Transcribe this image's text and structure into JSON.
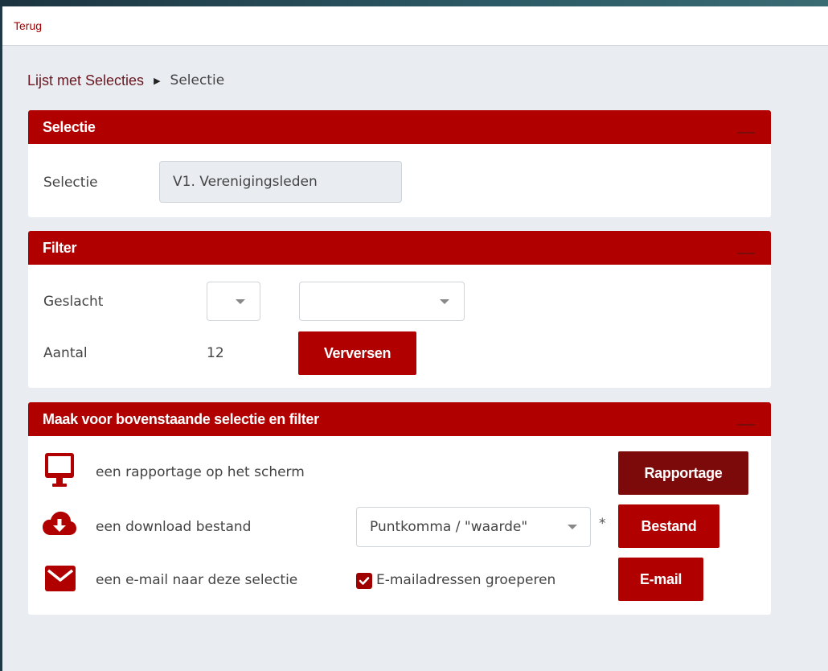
{
  "topbar": {
    "back_label": "Terug"
  },
  "breadcrumb": {
    "parent": "Lijst met Selecties",
    "current": "Selectie"
  },
  "selectie_panel": {
    "title": "Selectie",
    "field_label": "Selectie",
    "field_value": "V1. Verenigingsleden"
  },
  "filter_panel": {
    "title": "Filter",
    "gender_label": "Geslacht",
    "gender_operator_value": "",
    "gender_value": "",
    "count_label": "Aantal",
    "count_value": "12",
    "refresh_button": "Verversen"
  },
  "output_panel": {
    "title": "Maak voor bovenstaande selectie en filter",
    "report_text": "een rapportage op het scherm",
    "report_button": "Rapportage",
    "download_text": "een download bestand",
    "download_format": "Puntkomma / \"waarde\"",
    "download_asterisk": "*",
    "download_button": "Bestand",
    "email_text": "een e-mail naar deze selectie",
    "group_checkbox_label": "E-mailadressen groeperen",
    "group_checked": true,
    "email_button": "E-mail"
  },
  "colors": {
    "brand_red": "#b00000",
    "dark_red": "#7d0a0a",
    "background": "#e9edf1"
  }
}
